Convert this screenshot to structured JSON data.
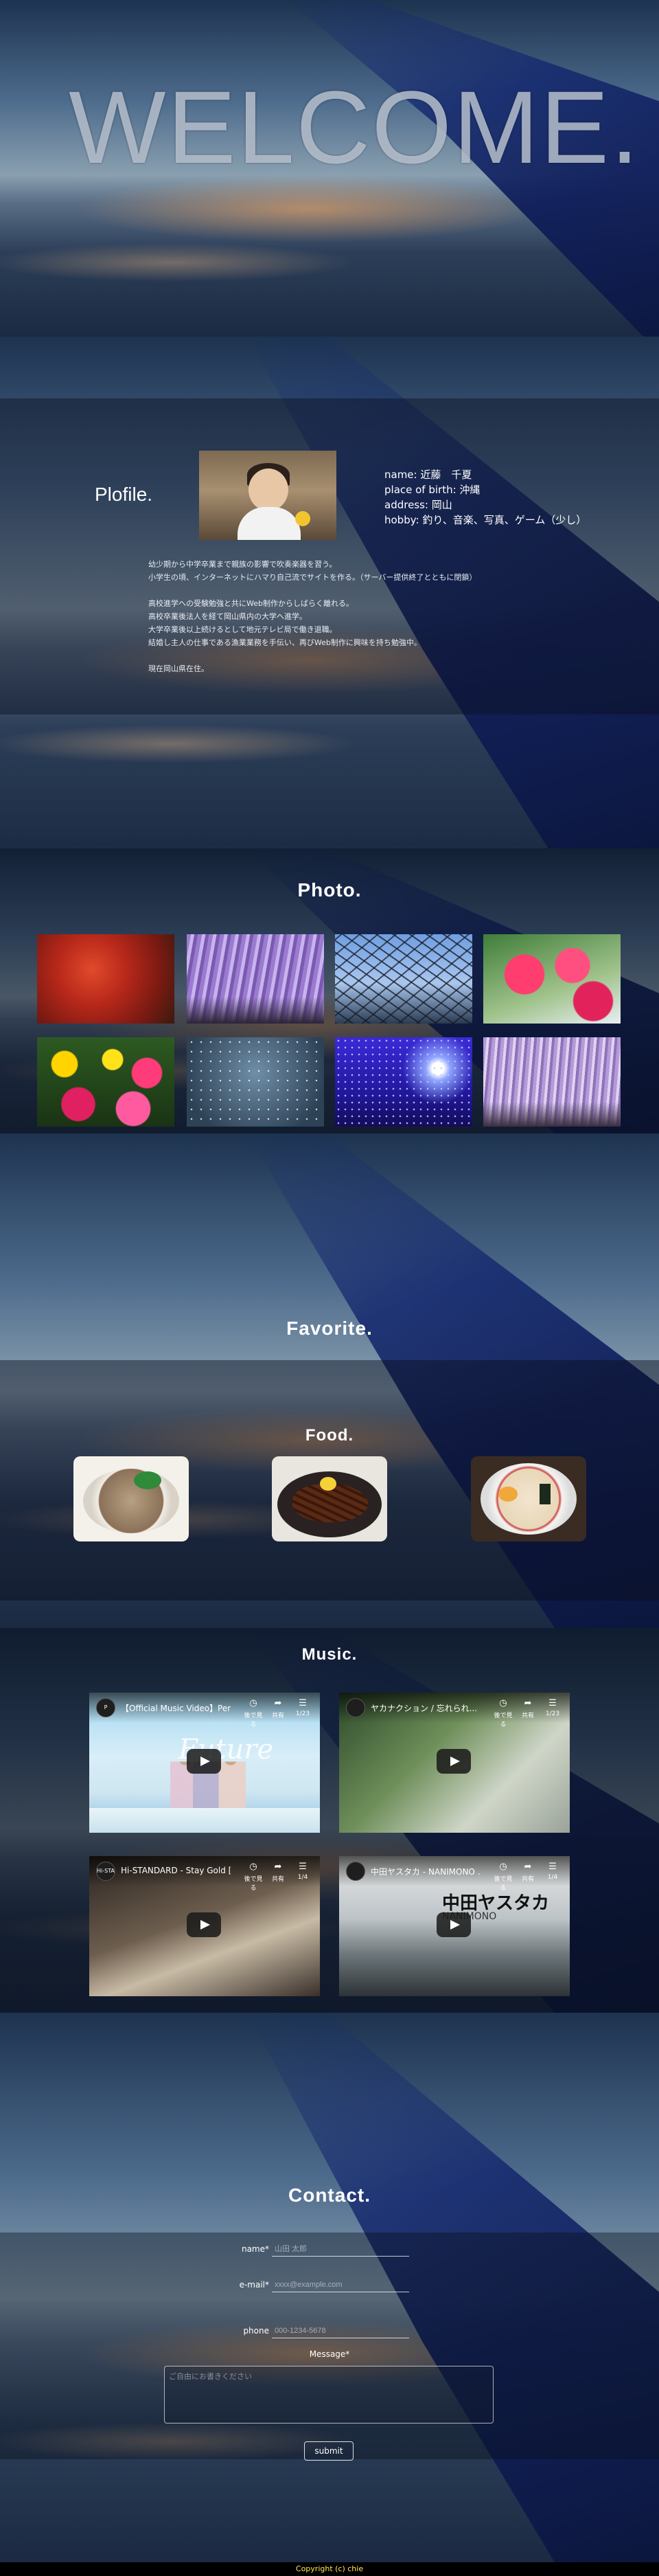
{
  "hero": {
    "title": "WELCOME."
  },
  "profile": {
    "section_title": "Plofile.",
    "info": [
      "name: 近藤　千夏",
      "place of birth: 沖縄",
      "address: 岡山",
      "hobby: 釣り、音楽、写真、ゲーム（少し）"
    ],
    "bio": [
      "幼少期から中学卒業まで親族の影響で吹奏楽器を習う。",
      "小学生の頃、インターネットにハマり自己流でサイトを作る。（サーバー提供終了とともに閉鎖）",
      "",
      "高校進学への受験勉強と共にWeb制作からしばらく離れる。",
      "高校卒業後法人を経て岡山県内の大学へ進学。",
      "大学卒業後以上続けるとして地元テレビ局で働き退職。",
      "結婚し主人の仕事である漁業業務を手伝い、再びWeb制作に興味を持ち勉強中。",
      "",
      "現在岡山県在住。"
    ]
  },
  "photo": {
    "section_title": "Photo."
  },
  "favorite": {
    "section_title": "Favorite.",
    "food_title": "Food.",
    "music_title": "Music."
  },
  "videos": [
    {
      "title": "【Official Music Video】Perfu...",
      "channel": "P",
      "actions": [
        "後で見る",
        "共有",
        "1/23"
      ]
    },
    {
      "title": "ヤカナクション / 忘れられ...",
      "channel": "",
      "actions": [
        "後で見る",
        "共有",
        "1/23"
      ]
    },
    {
      "title": "Hi-STANDARD - Stay Gold [O...",
      "channel": "Hi-STA",
      "actions": [
        "後で見る",
        "共有",
        "1/4"
      ]
    },
    {
      "title": "中田ヤスタカ - NANIMONO ...",
      "channel": "",
      "actions": [
        "後で見る",
        "共有",
        "1/4"
      ],
      "overlay_title": "中田ヤスタカ",
      "overlay_sub": "NANIMONO"
    }
  ],
  "contact": {
    "section_title": "Contact.",
    "name_label": "name*",
    "name_placeholder": "山田 太郎",
    "email_label": "e-mail*",
    "email_placeholder": "xxxx@example.com",
    "phone_label": "phone",
    "phone_placeholder": "000-1234-5678",
    "message_label": "Message*",
    "message_placeholder": "ご自由にお書きください",
    "submit_label": "submit"
  },
  "footer": {
    "copyright": "Copyright (c) chie"
  }
}
